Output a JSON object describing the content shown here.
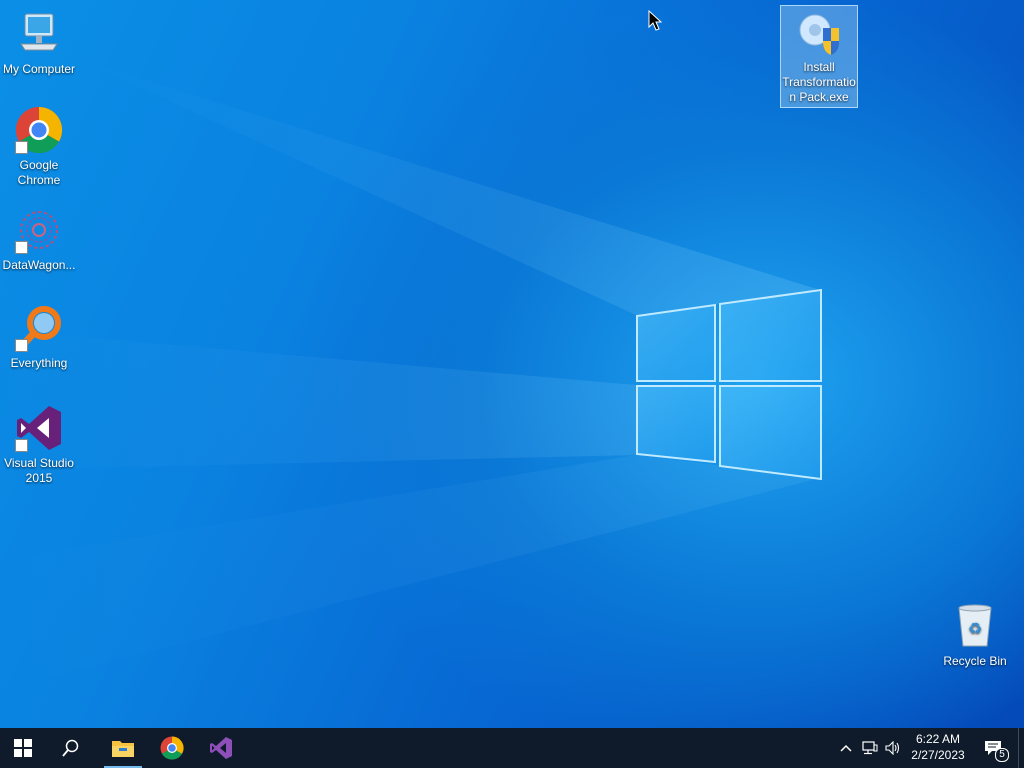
{
  "desktop": {
    "icons": [
      {
        "label": "My Computer",
        "icon": "computer-icon"
      },
      {
        "label": "Google Chrome",
        "icon": "chrome-icon"
      },
      {
        "label": "DataWagon...",
        "icon": "datawagon-icon"
      },
      {
        "label": "Everything",
        "icon": "everything-search-icon"
      },
      {
        "label": "Visual Studio 2015",
        "icon": "visual-studio-icon"
      },
      {
        "label": "Install Transformation Pack.exe",
        "icon": "installer-icon"
      },
      {
        "label": "Recycle Bin",
        "icon": "recycle-bin-icon"
      }
    ]
  },
  "taskbar": {
    "pinned": [
      {
        "name": "Start",
        "icon": "windows-start-icon"
      },
      {
        "name": "Search",
        "icon": "search-icon"
      },
      {
        "name": "File Explorer",
        "icon": "file-explorer-icon"
      },
      {
        "name": "Google Chrome",
        "icon": "chrome-icon"
      },
      {
        "name": "Visual Studio 2015",
        "icon": "visual-studio-icon"
      }
    ],
    "tray": {
      "time": "6:22 AM",
      "date": "2/27/2023",
      "notification_count": "5"
    }
  },
  "colors": {
    "taskbar": "#0f1b2a",
    "desktop_accent": "#0a78d6",
    "vs_purple": "#68217a"
  }
}
